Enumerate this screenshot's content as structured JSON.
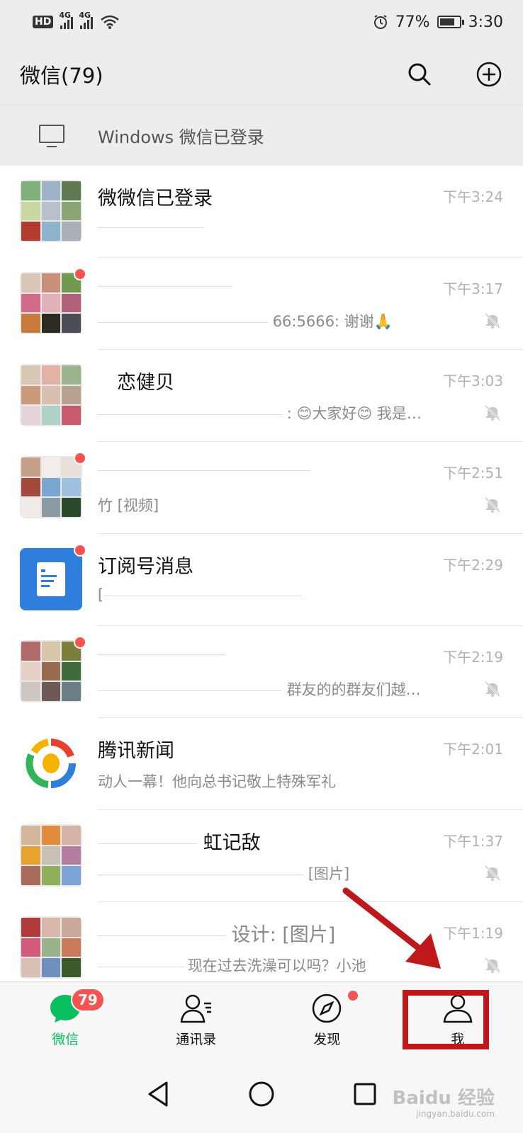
{
  "status_bar": {
    "hd": "HD",
    "net1": "4G",
    "net2": "4G",
    "battery": "77%",
    "battery_level": 0.77,
    "time": "3:30",
    "icons": [
      "signal-icon",
      "wifi-icon",
      "alarm-icon",
      "battery-icon"
    ]
  },
  "header": {
    "title": "微信(79)",
    "search_icon": "search-icon",
    "add_icon": "add-icon"
  },
  "windows_banner": {
    "text": "Windows 微信已登录",
    "icon": "monitor-icon"
  },
  "chats": [
    {
      "name": "微微信已登录",
      "preview": "",
      "time": "下午3:24",
      "muted": false,
      "unread_dot": false
    },
    {
      "name": "",
      "preview": "66:5666: 谢谢🙏",
      "time": "下午3:17",
      "muted": true,
      "unread_dot": true
    },
    {
      "name": "恋健贝",
      "preview": ": 😊大家好😊 我是…",
      "time": "下午3:03",
      "muted": true,
      "unread_dot": false
    },
    {
      "name": "",
      "preview": "竹 [视频]",
      "time": "下午2:51",
      "muted": true,
      "unread_dot": true
    },
    {
      "name": "订阅号消息",
      "preview": "[",
      "time": "下午2:29",
      "muted": false,
      "unread_dot": true
    },
    {
      "name": "",
      "preview": "群友的的群友们越…",
      "time": "下午2:19",
      "muted": true,
      "unread_dot": true
    },
    {
      "name": "腾讯新闻",
      "preview": "动人一幕！他向总书记敬上特殊军礼",
      "time": "下午2:01",
      "muted": false,
      "unread_dot": false
    },
    {
      "name": "虹记敌",
      "preview": "[图片]",
      "time": "下午1:37",
      "muted": true,
      "unread_dot": false
    },
    {
      "name": "设计: [图片]",
      "preview": "现在过去洗澡可以吗？小池",
      "time": "下午1:19",
      "muted": true,
      "unread_dot": false
    }
  ],
  "bottom_nav": {
    "items": [
      {
        "label": "微信",
        "icon": "chat-icon",
        "active": true,
        "badge": "79"
      },
      {
        "label": "通讯录",
        "icon": "contacts-icon",
        "active": false
      },
      {
        "label": "发现",
        "icon": "compass-icon",
        "active": false,
        "dot": true
      },
      {
        "label": "我",
        "icon": "person-icon",
        "active": false
      }
    ]
  },
  "system_nav": [
    "back-icon",
    "home-icon",
    "recents-icon"
  ],
  "watermark": {
    "main": "Baidu 经验",
    "sub": "jingyan.baidu.com"
  },
  "colors": {
    "accent": "#07c160",
    "badge": "#fa5151",
    "annotation": "#c0171b",
    "bg": "#ededed"
  }
}
